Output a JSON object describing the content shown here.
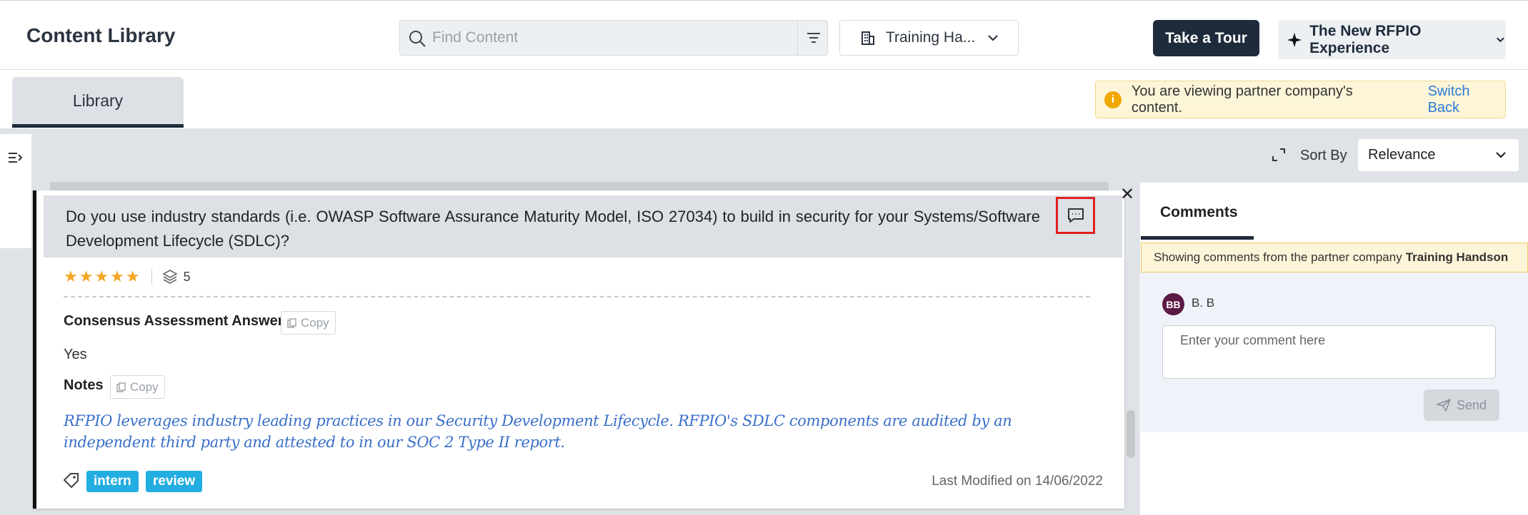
{
  "header": {
    "title": "Content Library",
    "search_placeholder": "Find Content",
    "scope": "Training Ha...",
    "tour_label": "Take a Tour",
    "experience_label": "The New RFPIO Experience"
  },
  "tabs": {
    "library": "Library"
  },
  "notice": {
    "text": "You are viewing partner company's content.",
    "link": "Switch Back"
  },
  "toolbar": {
    "sort_label": "Sort By",
    "sort_value": "Relevance"
  },
  "card": {
    "question": "Do you use industry standards (i.e. OWASP Software Assurance Maturity Model, ISO 27034) to build in security for your Systems/Software Development Lifecycle (SDLC)?",
    "stars": "★★★★★",
    "rating": 5,
    "layers_count": "5",
    "answers_label": "Consensus Assessment Answers",
    "copy_label": "Copy",
    "answer": "Yes",
    "notes_label": "Notes",
    "notes_text": "RFPIO leverages industry leading practices in our Security Development Lifecycle. RFPIO's SDLC components are audited by an independent third party and attested to in our SOC 2 Type II report.",
    "tags": [
      "intern",
      "review"
    ],
    "modified_label": "Last Modified on",
    "modified_date": "14/06/2022"
  },
  "comments": {
    "title": "Comments",
    "banner_text": "Showing comments from the partner company",
    "banner_company": "Training Handson",
    "avatar_initials": "BB",
    "user_name": "B. B",
    "input_placeholder": "Enter your comment here",
    "send_label": "Send"
  },
  "colors": {
    "primary_dark": "#1e2b3b",
    "tag_blue": "#22aee0",
    "star": "#f5a623",
    "highlight_red": "#e0201f",
    "avatar": "#5c1a44"
  }
}
